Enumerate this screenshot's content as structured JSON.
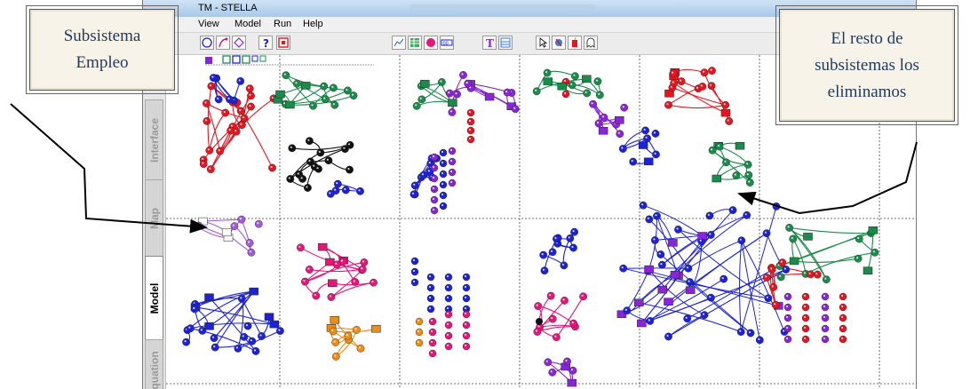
{
  "window": {
    "title": "TM - STELLA"
  },
  "menu": [
    {
      "label": "View"
    },
    {
      "label": "Model"
    },
    {
      "label": "Run"
    },
    {
      "label": "Help"
    }
  ],
  "tabs": [
    {
      "label": "Interface"
    },
    {
      "label": "Map"
    },
    {
      "label": "Model",
      "active": true
    },
    {
      "label": "quation"
    }
  ],
  "toolbar_icons": [
    "circle-tool-icon",
    "connector-tool-icon",
    "decision-tool-icon",
    "help-icon",
    "stop-icon",
    "graph-icon",
    "table-icon",
    "sector-icon",
    "numeric-display-icon",
    "text-icon",
    "io-icon",
    "pointer-icon",
    "hand-icon",
    "dynamite-icon",
    "ghost-icon"
  ],
  "callouts": {
    "left": {
      "line1": "Subsistema",
      "line2": "Empleo"
    },
    "right": {
      "line1": "El resto de",
      "line2": "subsistemas los",
      "line3": "eliminamos"
    }
  },
  "colors": {
    "red": "#e8141e",
    "green": "#1a8c4a",
    "blue": "#1c22d6",
    "purple": "#8a24d8",
    "black": "#111111",
    "pink": "#e8147c",
    "orange": "#f08c14",
    "lilac": "#a25ad8",
    "callout_text": "#1f3a5f",
    "callout_bg": "#f7f3e8"
  }
}
